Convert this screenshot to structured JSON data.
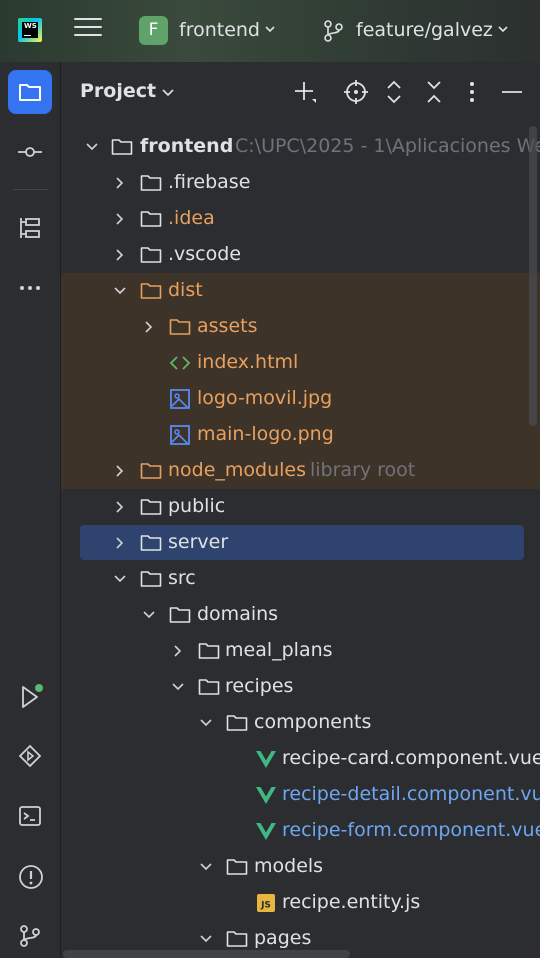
{
  "titlebar": {
    "app_logo_text": "WS",
    "project_badge": "F",
    "project_name": "frontend",
    "branch_name": "feature/galvez"
  },
  "panel": {
    "title": "Project"
  },
  "tree": {
    "root_name": "frontend",
    "root_path": "C:\\UPC\\2025 - 1\\Aplicaciones We",
    "firebase": ".firebase",
    "idea": ".idea",
    "vscode": ".vscode",
    "dist": "dist",
    "assets": "assets",
    "index_html": "index.html",
    "logo_movil": "logo-movil.jpg",
    "main_logo": "main-logo.png",
    "node_modules": "node_modules",
    "node_modules_hint": "library root",
    "public": "public",
    "server": "server",
    "src": "src",
    "domains": "domains",
    "meal_plans": "meal_plans",
    "recipes": "recipes",
    "components": "components",
    "recipe_card": "recipe-card.component.vue",
    "recipe_detail": "recipe-detail.component.vue",
    "recipe_form": "recipe-form.component.vue",
    "models": "models",
    "recipe_entity": "recipe.entity.js",
    "pages": "pages",
    "js_badge": "JS"
  },
  "colors": {
    "accent": "#3574f0",
    "selection": "#2e436e",
    "excluded_bg": "#3d3328",
    "excluded_text": "#e8a060",
    "vue_green": "#41b883",
    "modified_blue": "#6ea6f0"
  }
}
